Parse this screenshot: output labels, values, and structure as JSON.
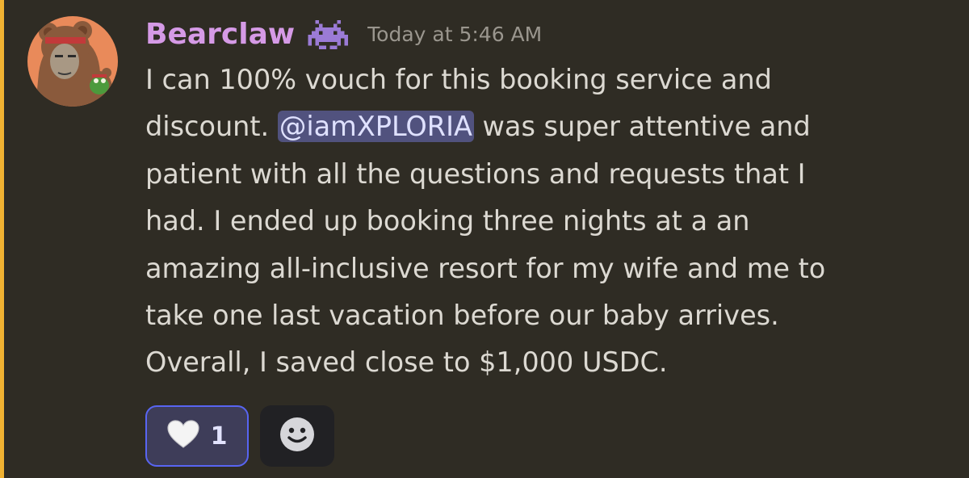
{
  "message": {
    "author": "Bearclaw",
    "author_color": "#d59ae6",
    "badge_icon": "space-invader-icon",
    "timestamp": "Today at 5:46 AM",
    "lines": [
      {
        "before": "I can 100% vouch for this booking service and"
      },
      {
        "before": "discount. ",
        "mention": "@iamXPLORIA",
        "after": " was super attentive and"
      },
      {
        "before": "patient with all the questions and requests that I"
      },
      {
        "before": "had. I ended up booking three nights at a an"
      },
      {
        "before": "amazing all-inclusive resort for my wife and me to"
      },
      {
        "before": "take one last vacation before our baby arrives."
      },
      {
        "before": "Overall, I saved close to $1,000 USDC."
      }
    ]
  },
  "reactions": [
    {
      "emoji": "white-heart-icon",
      "count": "1",
      "active": true
    }
  ],
  "add_reaction_icon": "smiley-face-icon",
  "colors": {
    "background": "#2f2c24",
    "highlight_bar": "#f0b232",
    "mention_bg": "#51527e",
    "reaction_border": "#5865f2"
  }
}
